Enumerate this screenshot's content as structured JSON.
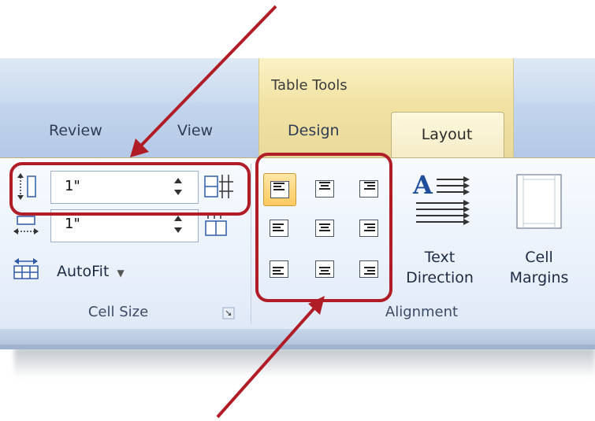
{
  "ribbon": {
    "contextual_group": "Table Tools",
    "tabs": {
      "review": "Review",
      "view": "View",
      "design": "Design",
      "layout": "Layout"
    },
    "cell_size": {
      "height_value": "1\"",
      "width_value": "1\"",
      "autofit_label": "AutoFit",
      "group_label": "Cell Size"
    },
    "alignment": {
      "group_label": "Alignment",
      "text_direction": [
        "Text",
        "Direction"
      ],
      "cell_margins": [
        "Cell",
        "Margins"
      ]
    }
  },
  "colors": {
    "arrow": "#b01d26",
    "context_tab": "#f4ebc5",
    "ribbon": "#eaf1fb"
  },
  "icons": [
    "row-height-icon",
    "distribute-rows-icon",
    "column-width-icon",
    "distribute-columns-icon",
    "autofit-icon",
    "text-direction-icon",
    "cell-margins-icon",
    "dialog-launcher-icon"
  ]
}
